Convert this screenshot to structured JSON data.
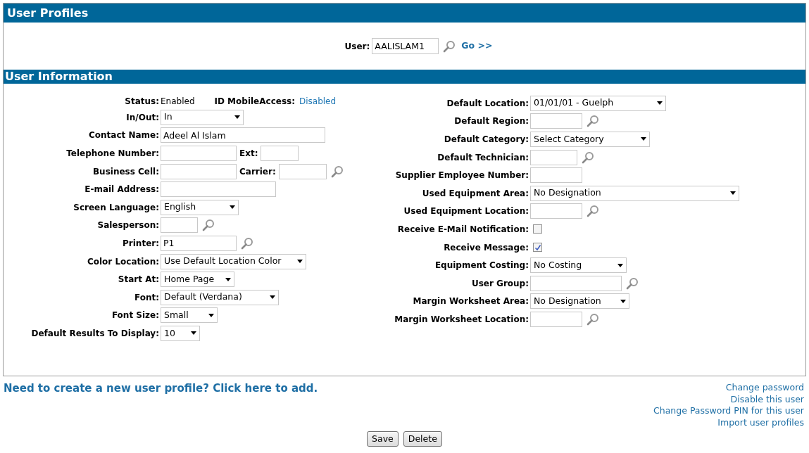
{
  "header": {
    "title": "User Profiles"
  },
  "user_lookup": {
    "label": "User:",
    "value": "AALISLAM1",
    "go": "Go >>"
  },
  "section": {
    "title": "User Information"
  },
  "left": [
    {
      "label": "Status:",
      "controls": [
        {
          "kind": "static",
          "text": "Enabled"
        },
        {
          "kind": "label",
          "text": "ID MobileAccess:"
        },
        {
          "kind": "link",
          "text": "Disabled"
        }
      ]
    },
    {
      "label": "In/Out:",
      "controls": [
        {
          "kind": "select",
          "value": "In"
        }
      ]
    },
    {
      "label": "Contact Name:",
      "controls": [
        {
          "kind": "text",
          "value": "Adeel Al Islam"
        }
      ]
    },
    {
      "label": "Telephone Number:",
      "controls": [
        {
          "kind": "text"
        },
        {
          "kind": "label",
          "text": "Ext:"
        },
        {
          "kind": "text"
        }
      ]
    },
    {
      "label": "Business Cell:",
      "controls": [
        {
          "kind": "text"
        },
        {
          "kind": "label",
          "text": "Carrier:"
        },
        {
          "kind": "text"
        },
        {
          "kind": "search"
        }
      ]
    },
    {
      "label": "E-mail Address:",
      "controls": [
        {
          "kind": "text"
        }
      ]
    },
    {
      "label": "Screen Language:",
      "controls": [
        {
          "kind": "select",
          "value": "English"
        }
      ]
    },
    {
      "label": "Salesperson:",
      "controls": [
        {
          "kind": "text"
        },
        {
          "kind": "search"
        }
      ]
    },
    {
      "label": "Printer:",
      "controls": [
        {
          "kind": "text",
          "value": "P1"
        },
        {
          "kind": "search"
        }
      ]
    },
    {
      "label": "Color Location:",
      "controls": [
        {
          "kind": "select",
          "value": "Use Default Location Color"
        }
      ]
    },
    {
      "label": "Start At:",
      "controls": [
        {
          "kind": "select",
          "value": "Home Page"
        }
      ]
    },
    {
      "label": "Font:",
      "controls": [
        {
          "kind": "select",
          "value": "Default (Verdana)"
        }
      ]
    },
    {
      "label": "Font Size:",
      "controls": [
        {
          "kind": "select",
          "value": "Small"
        }
      ]
    },
    {
      "label": "Default Results To Display:",
      "controls": [
        {
          "kind": "select",
          "value": "10"
        }
      ]
    }
  ],
  "right": [
    {
      "label": "Default Location:",
      "controls": [
        {
          "kind": "select",
          "value": "01/01/01 - Guelph"
        }
      ]
    },
    {
      "label": "Default Region:",
      "controls": [
        {
          "kind": "text"
        },
        {
          "kind": "search"
        }
      ]
    },
    {
      "label": "Default Category:",
      "controls": [
        {
          "kind": "select",
          "value": "Select Category"
        }
      ]
    },
    {
      "label": "Default Technician:",
      "controls": [
        {
          "kind": "text"
        },
        {
          "kind": "search"
        }
      ]
    },
    {
      "label": "Supplier Employee Number:",
      "controls": [
        {
          "kind": "text"
        }
      ]
    },
    {
      "label": "Used Equipment Area:",
      "controls": [
        {
          "kind": "select",
          "value": "No Designation"
        }
      ]
    },
    {
      "label": "Used Equipment Location:",
      "controls": [
        {
          "kind": "text"
        },
        {
          "kind": "search"
        }
      ]
    },
    {
      "label": "Receive E-Mail Notification:",
      "controls": [
        {
          "kind": "checkbox",
          "checked": false
        }
      ]
    },
    {
      "label": "Receive Message:",
      "controls": [
        {
          "kind": "checkbox",
          "checked": true
        }
      ]
    },
    {
      "label": "Equipment Costing:",
      "controls": [
        {
          "kind": "select",
          "value": "No Costing"
        }
      ]
    },
    {
      "label": "User Group:",
      "controls": [
        {
          "kind": "text"
        },
        {
          "kind": "search"
        }
      ]
    },
    {
      "label": "Margin Worksheet Area:",
      "controls": [
        {
          "kind": "select",
          "value": "No Designation"
        }
      ]
    },
    {
      "label": "Margin Worksheet Location:",
      "controls": [
        {
          "kind": "text"
        },
        {
          "kind": "search"
        }
      ]
    }
  ],
  "add_link": "Need to create a new user profile? Click here to add.",
  "side_links": [
    "Change password",
    "Disable this user",
    "Change Password PIN for this user",
    "Import user profiles"
  ],
  "buttons": [
    "Save",
    "Delete"
  ]
}
